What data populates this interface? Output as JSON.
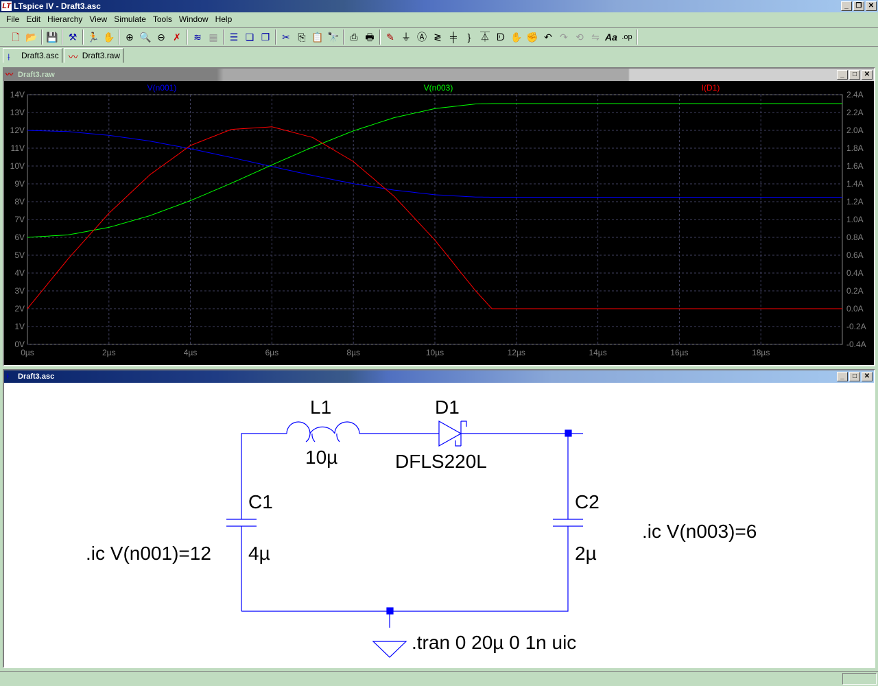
{
  "window": {
    "title": "LTspice IV - Draft3.asc"
  },
  "menu": [
    "File",
    "Edit",
    "Hierarchy",
    "View",
    "Simulate",
    "Tools",
    "Window",
    "Help"
  ],
  "toolbar_icons": [
    "new-schematic",
    "open",
    "save",
    "control-panel",
    "run",
    "halt",
    "zoom-in",
    "zoom-pan",
    "zoom-out",
    "zoom-fit",
    "autorange",
    "grid",
    "tile-horizontal",
    "cascade",
    "tile-vertical",
    "cut",
    "copy",
    "paste",
    "find",
    "print-preview",
    "print",
    "draw-wire",
    "ground",
    "label-net",
    "resistor",
    "capacitor",
    "inductor",
    "diode",
    "component",
    "move",
    "drag",
    "undo",
    "redo",
    "rotate",
    "mirror",
    "text",
    "spice-directive"
  ],
  "tabs": [
    {
      "label": "Draft3.asc"
    },
    {
      "label": "Draft3.raw"
    }
  ],
  "plot_window": {
    "title": "Draft3.raw"
  },
  "schematic_window": {
    "title": "Draft3.asc"
  },
  "chart_data": {
    "type": "line",
    "x_unit": "µs",
    "xlim": [
      0,
      20
    ],
    "xticks": [
      "0µs",
      "2µs",
      "4µs",
      "6µs",
      "8µs",
      "10µs",
      "12µs",
      "14µs",
      "16µs",
      "18µs"
    ],
    "y_left": {
      "lim": [
        0,
        14
      ],
      "ticks": [
        "0V",
        "1V",
        "2V",
        "3V",
        "4V",
        "5V",
        "6V",
        "7V",
        "8V",
        "9V",
        "10V",
        "11V",
        "12V",
        "13V",
        "14V"
      ]
    },
    "y_right": {
      "lim": [
        -0.4,
        2.4
      ],
      "ticks": [
        "-0.4A",
        "-0.2A",
        "0.0A",
        "0.2A",
        "0.4A",
        "0.6A",
        "0.8A",
        "1.0A",
        "1.2A",
        "1.4A",
        "1.6A",
        "1.8A",
        "2.0A",
        "2.2A",
        "2.4A"
      ]
    },
    "grid": true,
    "x": [
      0,
      1,
      2,
      3,
      4,
      5,
      6,
      7,
      8,
      9,
      10,
      11,
      11.4,
      20
    ],
    "series": [
      {
        "name": "V(n001)",
        "axis": "left",
        "color": "#0000ff",
        "values": [
          12,
          11.93,
          11.72,
          11.4,
          10.97,
          10.48,
          9.97,
          9.47,
          9.01,
          8.65,
          8.39,
          8.26,
          8.25,
          8.25
        ]
      },
      {
        "name": "V(n003)",
        "axis": "left",
        "color": "#00ff00",
        "values": [
          6,
          6.14,
          6.56,
          7.21,
          8.06,
          9.03,
          10.06,
          11.06,
          11.97,
          12.71,
          13.22,
          13.48,
          13.5,
          13.5
        ]
      },
      {
        "name": "I(D1)",
        "axis": "right",
        "color": "#ff0000",
        "values": [
          0,
          0.56,
          1.07,
          1.5,
          1.83,
          2.01,
          2.04,
          1.92,
          1.65,
          1.26,
          0.77,
          0.2,
          0,
          0
        ]
      }
    ]
  },
  "schematic": {
    "L1": {
      "name": "L1",
      "value": "10µ"
    },
    "D1": {
      "name": "D1",
      "value": "DFLS220L"
    },
    "C1": {
      "name": "C1",
      "value": "4µ"
    },
    "C2": {
      "name": "C2",
      "value": "2µ"
    },
    "ic1": ".ic V(n001)=12",
    "ic2": ".ic V(n003)=6",
    "tran": ".tran 0 20µ 0 1n uic"
  }
}
